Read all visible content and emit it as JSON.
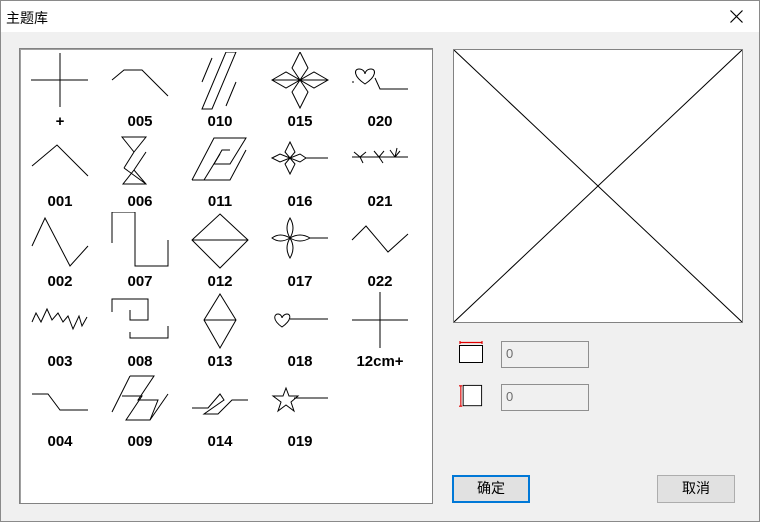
{
  "window": {
    "title": "主题库"
  },
  "patterns": [
    {
      "id": "plus",
      "label": "+"
    },
    {
      "id": "001",
      "label": "001"
    },
    {
      "id": "002",
      "label": "002"
    },
    {
      "id": "003",
      "label": "003"
    },
    {
      "id": "004",
      "label": "004"
    },
    {
      "id": "005",
      "label": "005"
    },
    {
      "id": "006",
      "label": "006"
    },
    {
      "id": "007",
      "label": "007"
    },
    {
      "id": "008",
      "label": "008"
    },
    {
      "id": "009",
      "label": "009"
    },
    {
      "id": "010",
      "label": "010"
    },
    {
      "id": "011",
      "label": "011"
    },
    {
      "id": "012",
      "label": "012"
    },
    {
      "id": "013",
      "label": "013"
    },
    {
      "id": "014",
      "label": "014"
    },
    {
      "id": "015",
      "label": "015"
    },
    {
      "id": "016",
      "label": "016"
    },
    {
      "id": "017",
      "label": "017"
    },
    {
      "id": "018",
      "label": "018"
    },
    {
      "id": "019",
      "label": "019"
    },
    {
      "id": "020",
      "label": "020"
    },
    {
      "id": "021",
      "label": "021"
    },
    {
      "id": "022",
      "label": "022"
    },
    {
      "id": "12cm",
      "label": "12cm+"
    }
  ],
  "size": {
    "width_value": "0",
    "height_value": "0"
  },
  "buttons": {
    "ok": "确定",
    "cancel": "取消"
  },
  "colors": {
    "dimension_arrow": "#e00000"
  }
}
